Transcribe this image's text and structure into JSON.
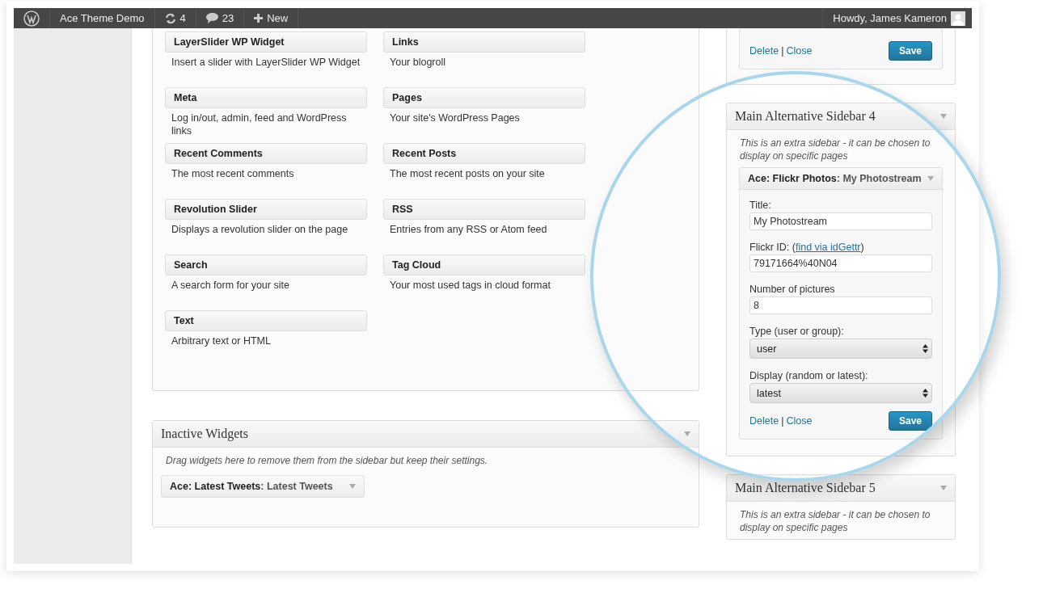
{
  "admin_bar": {
    "site_name": "Ace Theme Demo",
    "updates": "4",
    "comments": "23",
    "new_label": "New",
    "greeting": "Howdy, James Kameron"
  },
  "available_widgets": [
    {
      "name": "LayerSlider WP Widget",
      "description": "Insert a slider with LayerSlider WP Widget"
    },
    {
      "name": "Links",
      "description": "Your blogroll"
    },
    {
      "name": "Meta",
      "description": "Log in/out, admin, feed and WordPress links"
    },
    {
      "name": "Pages",
      "description": "Your site's WordPress Pages"
    },
    {
      "name": "Recent Comments",
      "description": "The most recent comments"
    },
    {
      "name": "Recent Posts",
      "description": "The most recent posts on your site"
    },
    {
      "name": "Revolution Slider",
      "description": "Displays a revolution slider on the page"
    },
    {
      "name": "RSS",
      "description": "Entries from any RSS or Atom feed"
    },
    {
      "name": "Search",
      "description": "A search form for your site"
    },
    {
      "name": "Tag Cloud",
      "description": "Your most used tags in cloud format"
    },
    {
      "name": "Text",
      "description": "Arbitrary text or HTML"
    }
  ],
  "inactive_widgets": {
    "title": "Inactive Widgets",
    "description": "Drag widgets here to remove them from the sidebar but keep their settings.",
    "widgets": [
      {
        "name": "Ace: Latest Tweets",
        "title": ": Latest Tweets"
      }
    ]
  },
  "top_panel": {
    "delete": "Delete",
    "separator": "|",
    "close": "Close",
    "save": "Save"
  },
  "sidebars": [
    {
      "title": "Main Alternative Sidebar 4",
      "description": "This is an extra sidebar - it can be chosen to display on specific pages",
      "widget": {
        "name": "Ace: Flickr Photos",
        "title": ": My Photostream",
        "fields": [
          {
            "kind": "text",
            "label": "Title:",
            "value": "My Photostream"
          },
          {
            "kind": "text",
            "label": "Flickr ID: (",
            "link": "find via idGettr",
            "label_end": ")",
            "value": "79171664%40N04"
          },
          {
            "kind": "text",
            "label": "Number of pictures",
            "value": "8"
          },
          {
            "kind": "select",
            "label": "Type (user or group):",
            "value": "user"
          },
          {
            "kind": "select",
            "label": "Display (random or latest):",
            "value": "latest"
          }
        ],
        "delete": "Delete",
        "separator": "|",
        "close": "Close",
        "save": "Save"
      }
    },
    {
      "title": "Main Alternative Sidebar 5",
      "description": "This is an extra sidebar - it can be chosen to display on specific pages"
    }
  ]
}
